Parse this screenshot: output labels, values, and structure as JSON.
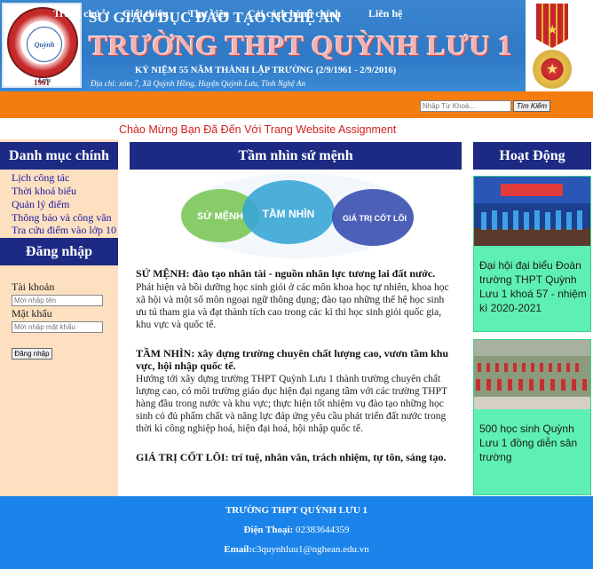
{
  "banner": {
    "line1": "SỞ GIÁO DỤC ĐÀO TẠO NGHỆ AN",
    "line2": "TRƯỜNG THPT QUỲNH LƯU 1",
    "line3": "KỶ NIỆM 55 NĂM THÀNH LẬP TRƯỜNG (2/9/1961 - 2/9/2016)",
    "line4": "Địa chỉ: xóm 7, Xã Quỳnh Hồng,  Huyện Quỳnh Lưu, Tỉnh Nghệ An",
    "logo_text": "Quỳnh Lưu",
    "logo_year": "1961"
  },
  "nav": {
    "items": [
      "Trang chủ",
      "Giới thiệu",
      "Thư viện",
      "Cải cách hành chính",
      "Liên hệ"
    ],
    "search_placeholder": "Nhập Từ Khoá...",
    "search_button": "Tìm Kiếm"
  },
  "welcome": "Chào Mừng Bạn Đã Đến Với Trang Website Assignment",
  "sidebar": {
    "title": "Danh mục chính",
    "links": [
      "Lịch công tác",
      "Thời khoá biểu",
      "Quản lý điểm",
      "Thông báo và công văn",
      "Tra cứu điểm vào lớp 10"
    ]
  },
  "login": {
    "title": "Đăng nhập",
    "username_label": "Tài khoản",
    "username_placeholder": "Mời nhập tên",
    "password_label": "Mật khẩu",
    "password_placeholder": "Mời nhập mật khẩu",
    "button": "Đăng nhập"
  },
  "center": {
    "title": "Tầm nhìn sứ mệnh",
    "image_labels": [
      "SỨ MỆNH",
      "TẦM NHÌN",
      "GIÁ TRỊ CỐT LÕI"
    ],
    "mission_heading": "SỨ MỆNH: đào tạo nhân tài - nguồn nhân lực tương lai đất nước.",
    "mission_text": "Phát hiện và bồi dưỡng học sinh giỏi ở các môn khoa học tự nhiên, khoa học xã hội và một số môn ngoại ngữ thông dụng; đào tạo những thế hệ học sinh ưu tú tham gia và đạt thành tích cao trong các kì thi học sinh giỏi quốc gia, khu vực và quốc tế.",
    "vision_heading": "TẦM NHÌN: xây dựng trường chuyên chất lượng cao, vươn tầm khu vực, hội nhập quốc tế.",
    "vision_text": "Hướng tới xây dựng trường THPT Quỳnh Lưu 1 thành trường chuyên chất lượng cao, có môi trường giáo dục hiện đại ngang tầm với các trường THPT hàng đầu trong nước và khu vực; thực hiện tốt nhiệm vụ đào tạo những học sinh có đủ phẩm chất và năng lực đáp ứng yêu cầu phát triển đất nước trong thời kì công nghiệp hoá, hiện đại hoá, hội nhập quốc tế.",
    "values_heading": "GIÁ TRỊ CỐT LÕI: trí tuệ, nhân văn, trách nhiệm, tự tôn, sáng tạo."
  },
  "activities": {
    "title": "Hoạt Động",
    "items": [
      {
        "text": "Đại hội đại biểu Đoàn trường THPT Quỳnh Lưu 1 khoá 57 - nhiệm kì 2020-2021"
      },
      {
        "text": "500 học sinh Quỳnh Lưu 1 đồng diễn sân trường"
      }
    ]
  },
  "footer": {
    "school": "TRƯỜNG THPT QUỲNH LƯU 1",
    "phone_label": "Điện Thoại:",
    "phone": "02383644359",
    "email_label": "Email:",
    "email": "c3quynhluu1@nghean.edu.vn"
  },
  "colors": {
    "nav": "#f47d0f",
    "section_title": "#1c2a83",
    "sidebar_bg": "#fde0c0",
    "news_card": "#5ef0b3",
    "footer": "#1b84ea",
    "welcome": "#d42020"
  }
}
